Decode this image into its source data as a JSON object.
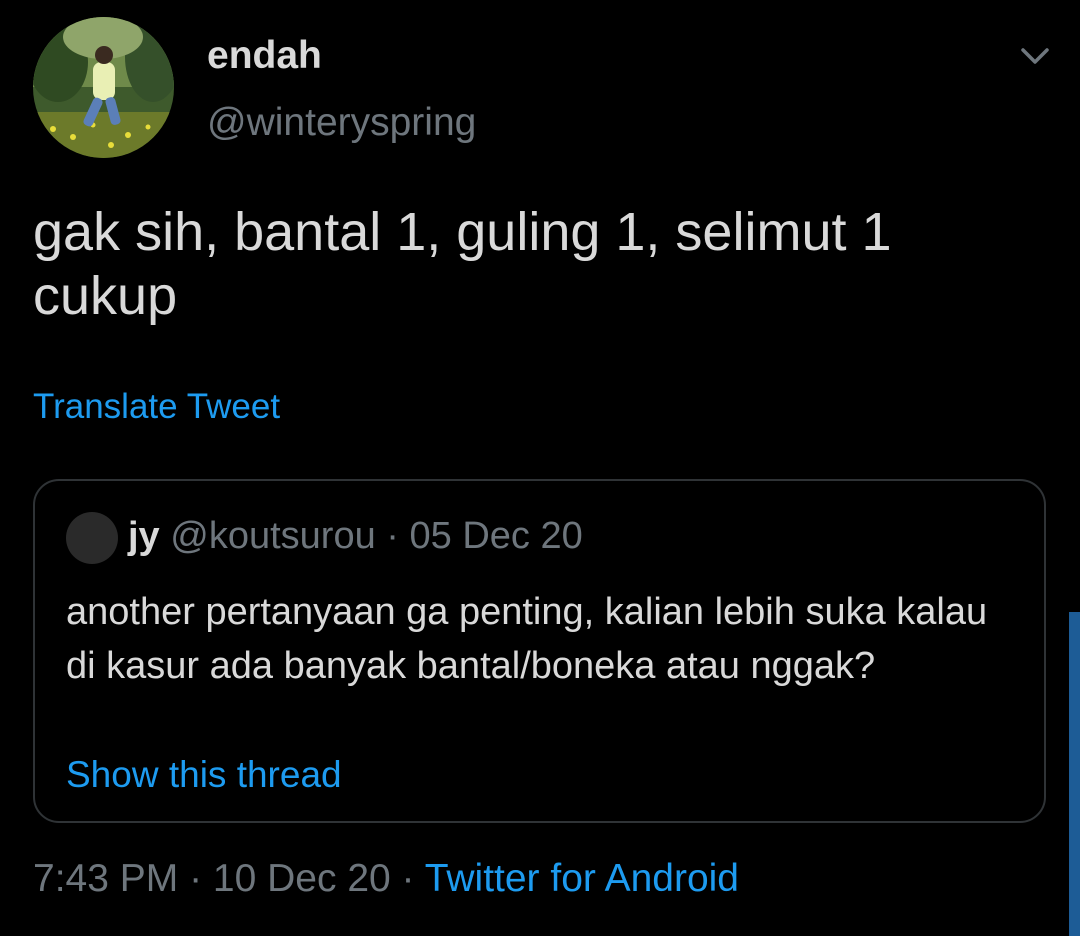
{
  "author": {
    "display_name": "endah",
    "handle": "@winteryspring",
    "avatar": "profile-photo"
  },
  "tweet": {
    "text": "gak sih, bantal 1, guling 1, selimut 1 cukup",
    "translate_label": "Translate Tweet"
  },
  "quoted_tweet": {
    "name": "jy",
    "handle": "@koutsurou",
    "separator": "·",
    "date": "05 Dec 20",
    "text": "another pertanyaan ga penting, kalian lebih suka kalau di kasur ada banyak bantal/boneka atau nggak?",
    "show_thread_label": "Show this thread"
  },
  "meta": {
    "time": "7:43 PM",
    "separator_1": " · ",
    "date": "10 Dec 20",
    "separator_2": " · ",
    "source": "Twitter for Android"
  },
  "icons": {
    "menu": "chevron-down-icon"
  },
  "colors": {
    "background": "#000000",
    "text_primary": "#d9d9d9",
    "text_secondary": "#6e767d",
    "accent": "#1d9bf0",
    "border": "#2f3336"
  }
}
